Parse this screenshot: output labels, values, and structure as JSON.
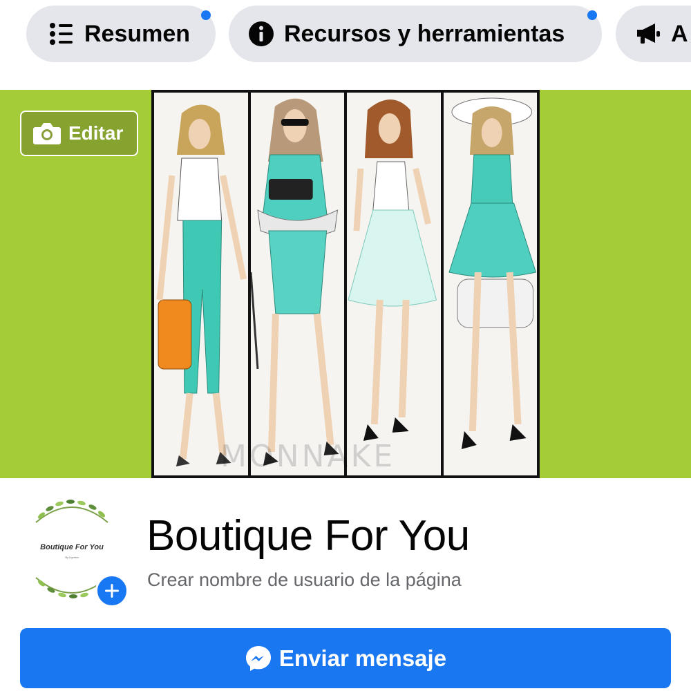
{
  "tabs": [
    {
      "label": "Resumen",
      "icon": "list-icon",
      "has_notification": true
    },
    {
      "label": "Recursos y herramientas",
      "icon": "info-icon",
      "has_notification": true
    },
    {
      "label": "A",
      "icon": "megaphone-icon",
      "has_notification": false
    }
  ],
  "cover": {
    "edit_label": "Editar",
    "background_color": "#a4cc39",
    "watermark": "MONNAKE"
  },
  "profile": {
    "avatar_brand": "Boutique For You",
    "avatar_subtitle": "By Liyrerra",
    "page_name": "Boutique For You",
    "username_prompt": "Crear nombre de usuario de la página"
  },
  "actions": {
    "message_label": "Enviar mensaje",
    "message_icon": "messenger-icon"
  },
  "colors": {
    "accent": "#1877f2",
    "chip_bg": "#e4e6eb",
    "text_primary": "#050505",
    "text_secondary": "#65676b"
  }
}
